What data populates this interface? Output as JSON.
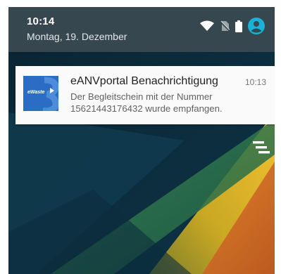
{
  "status_bar": {
    "time": "10:14",
    "date": "Montag, 19. Dezember",
    "icons": [
      "wifi-icon",
      "no-sim-icon",
      "battery-icon",
      "account-icon"
    ],
    "accent_color": "#1ab2d6"
  },
  "notification": {
    "app_icon": "eanvportal-app-icon",
    "app_icon_text": "eWaste",
    "title": "eANVportal Benachrichtigung",
    "time": "10:13",
    "text_line_1": "Der Begleitschein mit der Nummer",
    "text_line_2": "15621443176432 wurde empfangen."
  },
  "actions": {
    "clear_all_icon": "clear-all-icon"
  }
}
